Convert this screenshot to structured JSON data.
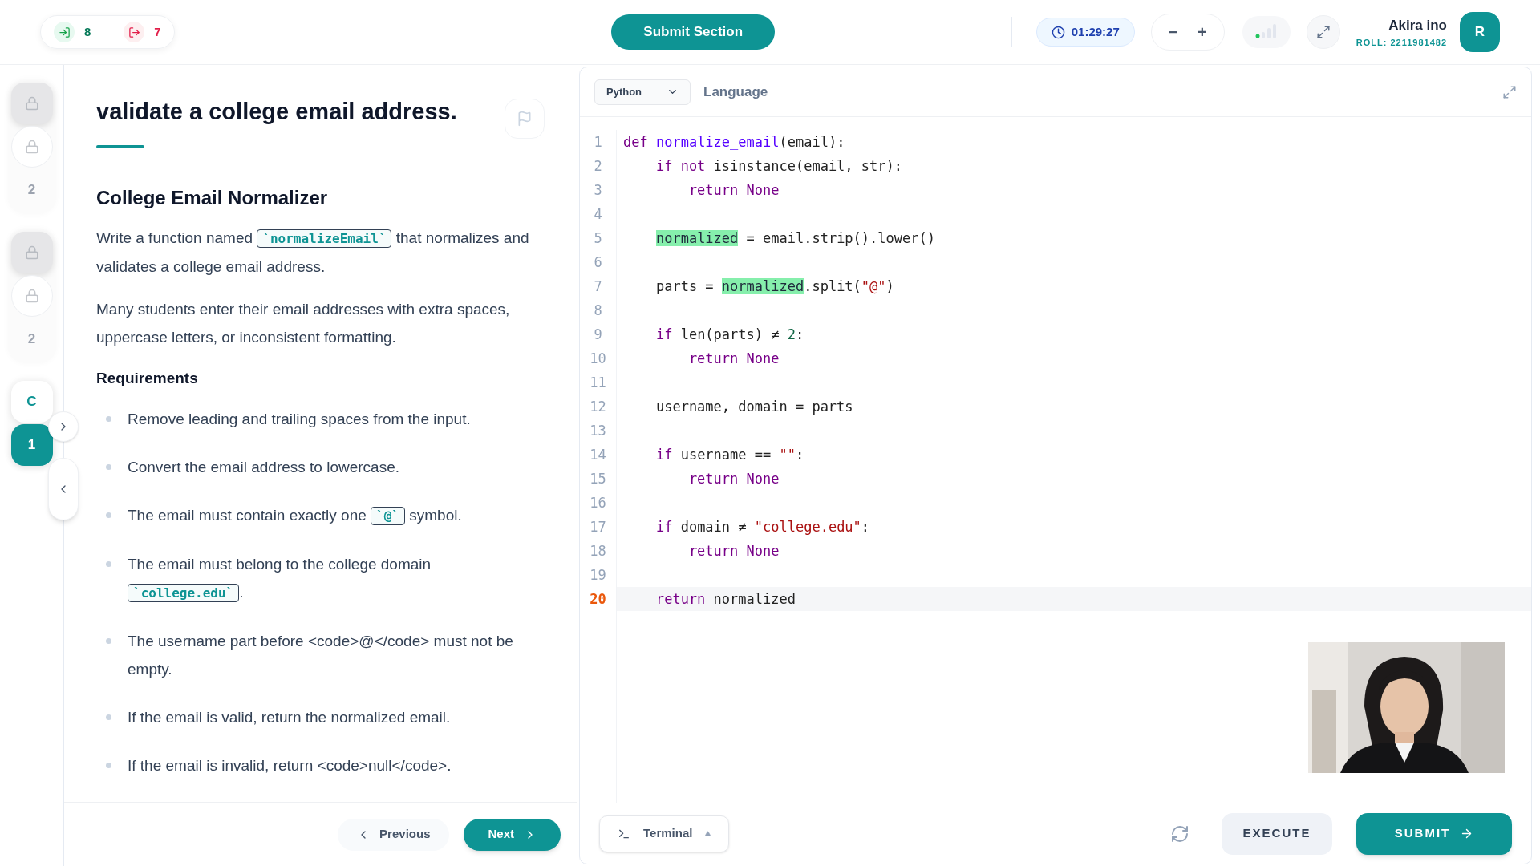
{
  "header": {
    "entries": "8",
    "exits": "7",
    "submit_section": "Submit Section",
    "timer": "01:29:27",
    "zoom_out": "−",
    "zoom_in": "+",
    "user_name": "Akira ino",
    "roll": "ROLL: 2211981482",
    "avatar": "R"
  },
  "sidebar": {
    "groups": [
      {
        "items": [
          {
            "kind": "lock",
            "raised": true,
            "selected": false
          },
          {
            "kind": "lock",
            "raised": false,
            "selected": false
          },
          {
            "kind": "number",
            "label": "2",
            "raised": false,
            "selected": false
          }
        ]
      },
      {
        "items": [
          {
            "kind": "lock",
            "raised": true,
            "selected": false
          },
          {
            "kind": "lock",
            "raised": false,
            "selected": false
          },
          {
            "kind": "number",
            "label": "2",
            "raised": false,
            "selected": false
          }
        ]
      },
      {
        "items": [
          {
            "kind": "letter",
            "label": "C",
            "raised": true,
            "selected": false
          },
          {
            "kind": "number",
            "label": "1",
            "raised": true,
            "selected": true
          }
        ]
      }
    ]
  },
  "problem": {
    "title": "validate a college email address.",
    "heading": "College Email Normalizer",
    "paragraphs": [
      [
        {
          "kind": "text",
          "text": "Write a function named "
        },
        {
          "kind": "code",
          "text": "`normalizeEmail`"
        },
        {
          "kind": "text",
          "text": " that normalizes and validates a college email address."
        }
      ],
      [
        {
          "kind": "text",
          "text": "Many students enter their email addresses with extra spaces, uppercase letters, or inconsistent formatting."
        }
      ]
    ],
    "requirements_heading": "Requirements",
    "requirements": [
      [
        {
          "kind": "text",
          "text": "Remove leading and trailing spaces from the input."
        }
      ],
      [
        {
          "kind": "text",
          "text": "Convert the email address to lowercase."
        }
      ],
      [
        {
          "kind": "text",
          "text": "The email must contain exactly one "
        },
        {
          "kind": "code",
          "text": "`@`"
        },
        {
          "kind": "text",
          "text": " symbol."
        }
      ],
      [
        {
          "kind": "text",
          "text": "The email must belong to the college domain "
        },
        {
          "kind": "code",
          "text": "`college.edu`"
        },
        {
          "kind": "text",
          "text": "."
        }
      ],
      [
        {
          "kind": "text",
          "text": "The username part before <code>@</code> must not be empty."
        }
      ],
      [
        {
          "kind": "text",
          "text": "If the email is valid, return the normalized email."
        }
      ],
      [
        {
          "kind": "text",
          "text": "If the email is invalid, return <code>null</code>."
        }
      ]
    ],
    "previous": "Previous",
    "next": "Next"
  },
  "editor": {
    "language": "Python",
    "language_label": "Language",
    "lines": [
      {
        "number": "1",
        "active": false,
        "tokens": [
          {
            "kind": "keyword",
            "text": "def "
          },
          {
            "kind": "function",
            "text": "normalize_email"
          },
          {
            "kind": "plain",
            "text": "(email):"
          }
        ]
      },
      {
        "number": "2",
        "active": false,
        "tokens": [
          {
            "kind": "keyword",
            "text": "    if not "
          },
          {
            "kind": "plain",
            "text": "isinstance(email, str):"
          }
        ]
      },
      {
        "number": "3",
        "active": false,
        "tokens": [
          {
            "kind": "keyword",
            "text": "        return None"
          }
        ]
      },
      {
        "number": "4",
        "active": false
      },
      {
        "number": "5",
        "active": false,
        "tokens": [
          {
            "kind": "highlight",
            "text": "    normalized"
          },
          {
            "kind": "plain",
            "text": " = email.strip().lower()"
          }
        ]
      },
      {
        "number": "6",
        "active": false
      },
      {
        "number": "7",
        "active": false,
        "tokens": [
          {
            "kind": "plain",
            "text": "    parts = "
          },
          {
            "kind": "highlight",
            "text": "normalized"
          },
          {
            "kind": "plain",
            "text": ".split("
          },
          {
            "kind": "string",
            "text": "\"@\""
          },
          {
            "kind": "plain",
            "text": ")"
          }
        ]
      },
      {
        "number": "8",
        "active": false
      },
      {
        "number": "9",
        "active": false,
        "tokens": [
          {
            "kind": "keyword",
            "text": "    if "
          },
          {
            "kind": "plain",
            "text": "len(parts) ≠ "
          },
          {
            "kind": "number",
            "text": "2"
          },
          {
            "kind": "plain",
            "text": ":"
          }
        ]
      },
      {
        "number": "10",
        "active": false,
        "tokens": [
          {
            "kind": "keyword",
            "text": "        return None"
          }
        ]
      },
      {
        "number": "11",
        "active": false
      },
      {
        "number": "12",
        "active": false,
        "tokens": [
          {
            "kind": "plain",
            "text": "    username, domain = parts"
          }
        ]
      },
      {
        "number": "13",
        "active": false
      },
      {
        "number": "14",
        "active": false,
        "tokens": [
          {
            "kind": "keyword",
            "text": "    if "
          },
          {
            "kind": "plain",
            "text": "username == "
          },
          {
            "kind": "string",
            "text": "\"\""
          },
          {
            "kind": "plain",
            "text": ":"
          }
        ]
      },
      {
        "number": "15",
        "active": false,
        "tokens": [
          {
            "kind": "keyword",
            "text": "        return None"
          }
        ]
      },
      {
        "number": "16",
        "active": false
      },
      {
        "number": "17",
        "active": false,
        "tokens": [
          {
            "kind": "keyword",
            "text": "    if "
          },
          {
            "kind": "plain",
            "text": "domain ≠ "
          },
          {
            "kind": "string",
            "text": "\"college.edu\""
          },
          {
            "kind": "plain",
            "text": ":"
          }
        ]
      },
      {
        "number": "18",
        "active": false,
        "tokens": [
          {
            "kind": "keyword",
            "text": "        return None"
          }
        ]
      },
      {
        "number": "19",
        "active": false
      },
      {
        "number": "20",
        "active": true,
        "tokens": [
          {
            "kind": "keyword",
            "text": "    return "
          },
          {
            "kind": "plain",
            "text": "normalized"
          }
        ]
      }
    ],
    "terminal": "Terminal",
    "execute": "EXECUTE",
    "submit": "SUBMIT"
  }
}
